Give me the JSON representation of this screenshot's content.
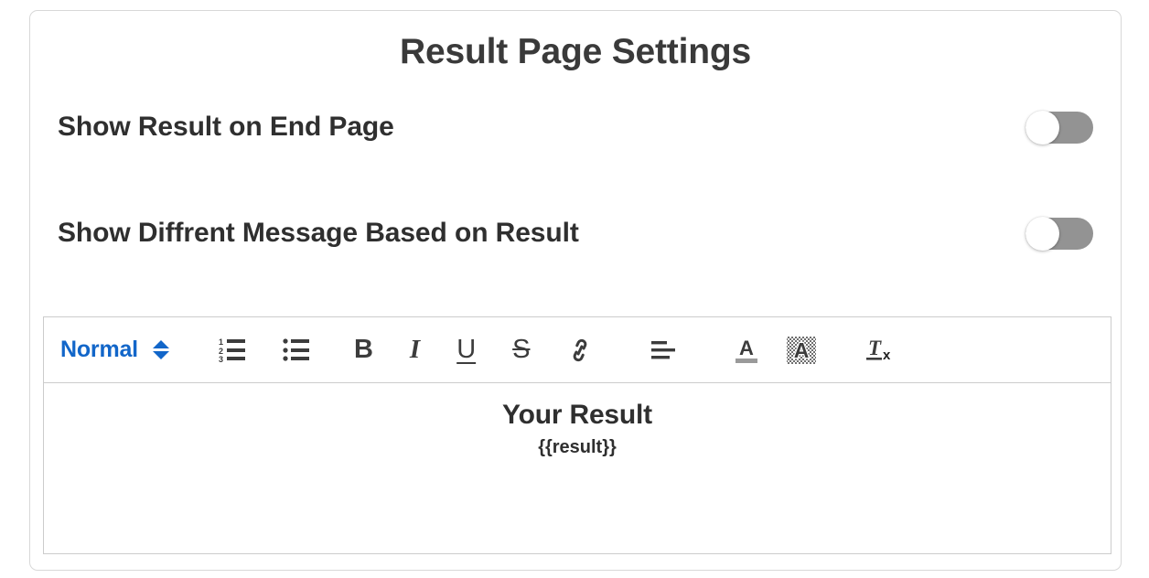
{
  "card": {
    "title": "Result Page Settings"
  },
  "settings": {
    "rows": [
      {
        "label": "Show Result on End Page",
        "toggle_state": "off",
        "toggle_name": "show-result-on-end-page-toggle"
      },
      {
        "label": "Show Diffrent Message Based on Result",
        "toggle_state": "off",
        "toggle_name": "show-different-message-toggle"
      }
    ]
  },
  "editor": {
    "toolbar": {
      "format_label": "Normal",
      "items": [
        {
          "name": "format-dropdown",
          "label": "Normal"
        },
        {
          "name": "ordered-list-icon",
          "label": "Ordered List"
        },
        {
          "name": "bullet-list-icon",
          "label": "Bullet List"
        },
        {
          "name": "bold-icon",
          "label": "B"
        },
        {
          "name": "italic-icon",
          "label": "I"
        },
        {
          "name": "underline-icon",
          "label": "U"
        },
        {
          "name": "strikethrough-icon",
          "label": "S"
        },
        {
          "name": "link-icon",
          "label": "Link"
        },
        {
          "name": "align-icon",
          "label": "Align"
        },
        {
          "name": "text-color-icon",
          "label": "A"
        },
        {
          "name": "background-color-icon",
          "label": "A"
        },
        {
          "name": "clear-format-icon",
          "label": "Tx"
        }
      ]
    },
    "content": {
      "heading": "Your Result",
      "placeholder_token": "{{result}}"
    }
  },
  "colors": {
    "accent_blue": "#1266c9",
    "toggle_track_off": "#939393",
    "text_dark": "#2f2f2f",
    "border": "#d8d8d8"
  }
}
